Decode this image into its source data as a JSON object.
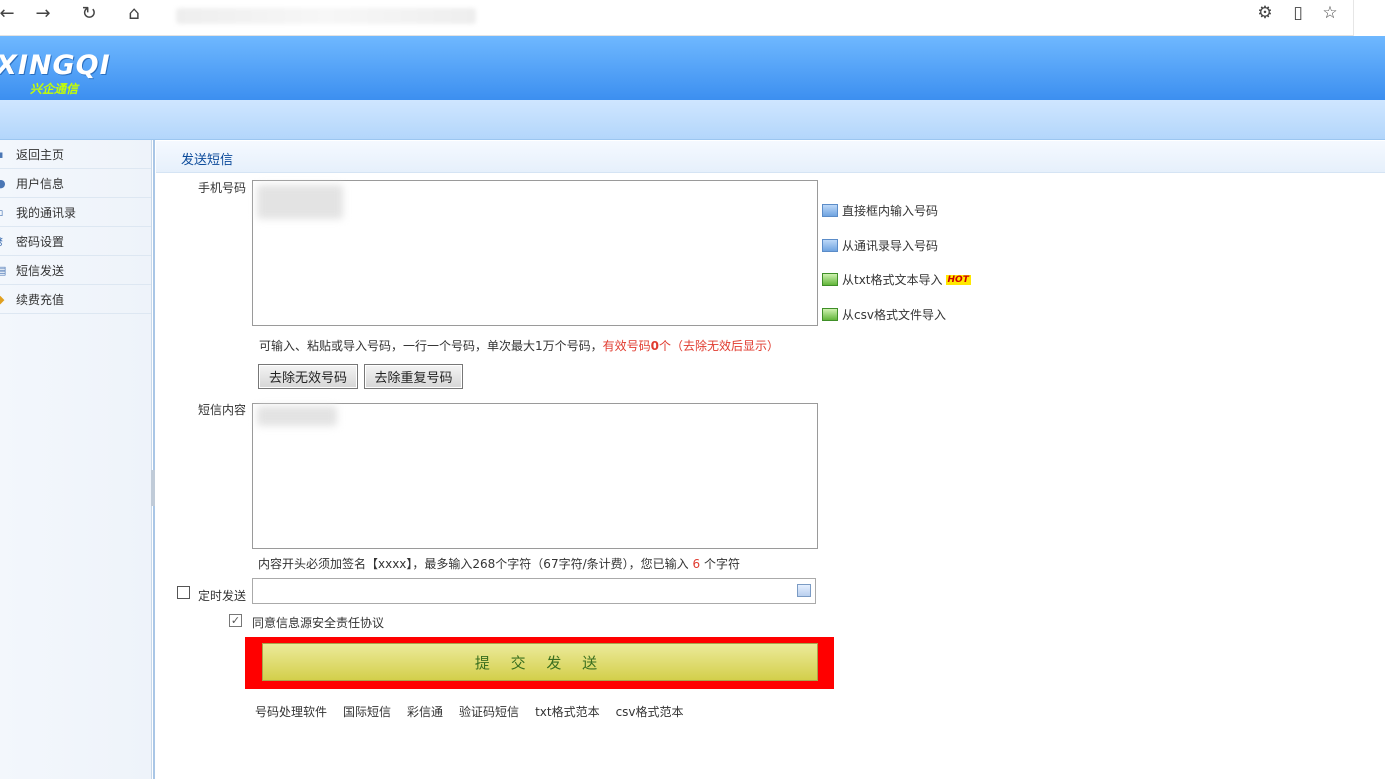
{
  "browser": {
    "nav": {
      "back": "←",
      "forward": "→",
      "reload": "↻",
      "home": "⌂"
    },
    "tools": {
      "extensions": "⚙",
      "reading": "▯",
      "favorite": "☆"
    }
  },
  "header": {
    "logo": "XINGQI",
    "logo_sub": "兴企通信"
  },
  "sidebar": {
    "items": [
      {
        "label": "返回主页",
        "icon": "home-icon"
      },
      {
        "label": "用户信息",
        "icon": "user-icon"
      },
      {
        "label": "我的通讯录",
        "icon": "contacts-icon"
      },
      {
        "label": "密码设置",
        "icon": "key-icon"
      },
      {
        "label": "短信发送",
        "icon": "sms-icon"
      },
      {
        "label": "续费充值",
        "icon": "recharge-icon"
      }
    ]
  },
  "main": {
    "title": "发送短信",
    "phone_label": "手机号码",
    "import_links": [
      {
        "label": "直接框内输入号码",
        "hot": ""
      },
      {
        "label": "从通讯录导入号码",
        "hot": ""
      },
      {
        "label": "从txt格式文本导入",
        "hot": "HOT"
      },
      {
        "label": "从csv格式文件导入",
        "hot": ""
      }
    ],
    "phone_hint_prefix": "可输入、粘贴或导入号码，一行一个号码，单次最大1万个号码，",
    "phone_hint_valid": "有效号码",
    "phone_hint_count": "0",
    "phone_hint_suffix": "个（去除无效后显示）",
    "remove_invalid": "去除无效号码",
    "remove_duplicate": "去除重复号码",
    "content_label": "短信内容",
    "content_hint_prefix": "内容开头必须加签名【xxxx】，最多输入268个字符（67字符/条计费），您已输入",
    "content_hint_count": "6",
    "content_hint_suffix": "个字符",
    "schedule_label": "定时发送",
    "agree_label": "同意信息源安全责任协议",
    "submit": "提 交 发 送",
    "footer_links": [
      "号码处理软件",
      "国际短信",
      "彩信通",
      "验证码短信",
      "txt格式范本",
      "csv格式范本"
    ]
  }
}
